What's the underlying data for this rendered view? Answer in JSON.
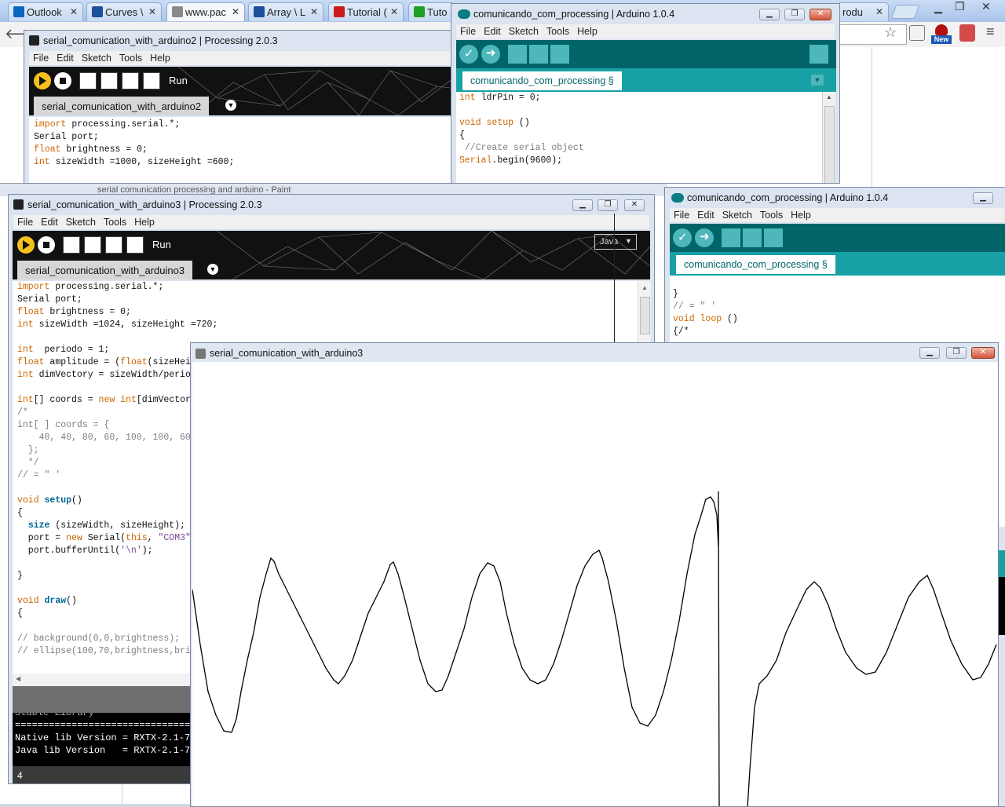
{
  "browser": {
    "tabs": [
      {
        "label": "Outlook",
        "color": "#0b64c0"
      },
      {
        "label": "Curves \\",
        "color": "#1c4e9a"
      },
      {
        "label": "www.pac",
        "color": "#8a8a8a"
      },
      {
        "label": "Array \\ L",
        "color": "#1c4e9a"
      },
      {
        "label": "Tutorial (",
        "color": "#cc1a1a"
      },
      {
        "label": "Tuto",
        "color": "#1fa023"
      }
    ],
    "far_tab": "rodu",
    "new_badge": "New"
  },
  "paint_behind_title": "serial comunication processing and arduino - Paint",
  "processing2": {
    "title": "serial_comunication_with_arduino2 | Processing 2.0.3",
    "menu": [
      "File",
      "Edit",
      "Sketch",
      "Tools",
      "Help"
    ],
    "run_label": "Run",
    "tab": "serial_comunication_with_arduino2",
    "code": [
      [
        {
          "t": "import",
          "c": "kw"
        },
        {
          "t": " processing.serial.*;"
        }
      ],
      [
        {
          "t": "Serial port;"
        }
      ],
      [
        {
          "t": "float",
          "c": "kt"
        },
        {
          "t": " brightness = 0;"
        }
      ],
      [
        {
          "t": "int",
          "c": "kt"
        },
        {
          "t": " sizeWidth =1000, sizeHeight =600;"
        }
      ]
    ]
  },
  "arduino1": {
    "title": "comunicando_com_processing | Arduino 1.0.4",
    "menu": [
      "File",
      "Edit",
      "Sketch",
      "Tools",
      "Help"
    ],
    "tab": "comunicando_com_processing §",
    "code": [
      [
        {
          "t": "int",
          "c": "kt"
        },
        {
          "t": " ldrPin = 0;"
        }
      ],
      [
        {
          "t": ""
        }
      ],
      [
        {
          "t": "void",
          "c": "kt"
        },
        {
          "t": " "
        },
        {
          "t": "setup",
          "c": "kw"
        },
        {
          "t": " ()"
        }
      ],
      [
        {
          "t": "{"
        }
      ],
      [
        {
          "t": " //Create serial object",
          "c": "cm"
        }
      ],
      [
        {
          "t": "Serial",
          "c": "kw"
        },
        {
          "t": ".begin(9600);"
        }
      ]
    ]
  },
  "arduino2": {
    "title": "comunicando_com_processing | Arduino 1.0.4",
    "menu": [
      "File",
      "Edit",
      "Sketch",
      "Tools",
      "Help"
    ],
    "tab": "comunicando_com_processing §",
    "code": [
      [
        {
          "t": ""
        }
      ],
      [
        {
          "t": "}"
        }
      ],
      [
        {
          "t": "// = \" '",
          "c": "cm"
        }
      ],
      [
        {
          "t": "void",
          "c": "kt"
        },
        {
          "t": " "
        },
        {
          "t": "loop",
          "c": "kw"
        },
        {
          "t": " ()"
        }
      ],
      [
        {
          "t": "{/*"
        }
      ]
    ]
  },
  "processing3": {
    "title": "serial_comunication_with_arduino3 | Processing 2.0.3",
    "menu": [
      "File",
      "Edit",
      "Sketch",
      "Tools",
      "Help"
    ],
    "run_label": "Run",
    "mode": "Java",
    "tab": "serial_comunication_with_arduino3",
    "code": [
      [
        {
          "t": "import",
          "c": "kw"
        },
        {
          "t": " processing.serial.*;"
        }
      ],
      [
        {
          "t": "Serial port;"
        }
      ],
      [
        {
          "t": "float",
          "c": "kt"
        },
        {
          "t": " brightness = 0;"
        }
      ],
      [
        {
          "t": "int",
          "c": "kt"
        },
        {
          "t": " sizeWidth =1024, sizeHeight =720;"
        }
      ],
      [
        {
          "t": ""
        }
      ],
      [
        {
          "t": "int",
          "c": "kt"
        },
        {
          "t": "  periodo = 1;"
        }
      ],
      [
        {
          "t": "float",
          "c": "kt"
        },
        {
          "t": " amplitude = ("
        },
        {
          "t": "float",
          "c": "kt"
        },
        {
          "t": "(sizeHei"
        }
      ],
      [
        {
          "t": "int",
          "c": "kt"
        },
        {
          "t": " dimVectory = sizeWidth/perio"
        }
      ],
      [
        {
          "t": ""
        }
      ],
      [
        {
          "t": "int",
          "c": "kt"
        },
        {
          "t": "[] coords = "
        },
        {
          "t": "new",
          "c": "kw"
        },
        {
          "t": " "
        },
        {
          "t": "int",
          "c": "kt"
        },
        {
          "t": "[dimVector"
        }
      ],
      [
        {
          "t": "/*",
          "c": "cm"
        }
      ],
      [
        {
          "t": "int[ ] coords = {",
          "c": "cm"
        }
      ],
      [
        {
          "t": "    40, 40, 80, 60, 100, 100, 60",
          "c": "cm"
        }
      ],
      [
        {
          "t": "  };",
          "c": "cm"
        }
      ],
      [
        {
          "t": "  */",
          "c": "cm"
        }
      ],
      [
        {
          "t": "// = \" '",
          "c": "cm"
        }
      ],
      [
        {
          "t": ""
        }
      ],
      [
        {
          "t": "void",
          "c": "kt"
        },
        {
          "t": " "
        },
        {
          "t": "setup",
          "c": "ab"
        },
        {
          "t": "()"
        }
      ],
      [
        {
          "t": "{"
        }
      ],
      [
        {
          "t": "  "
        },
        {
          "t": "size",
          "c": "ab"
        },
        {
          "t": " (sizeWidth, sizeHeight);"
        }
      ],
      [
        {
          "t": "  port = "
        },
        {
          "t": "new",
          "c": "kw"
        },
        {
          "t": " Serial("
        },
        {
          "t": "this",
          "c": "kw"
        },
        {
          "t": ", "
        },
        {
          "t": "\"COM3\"",
          "c": "st"
        }
      ],
      [
        {
          "t": "  port.bufferUntil("
        },
        {
          "t": "'\\n'",
          "c": "st"
        },
        {
          "t": ");"
        }
      ],
      [
        {
          "t": ""
        }
      ],
      [
        {
          "t": "}"
        }
      ],
      [
        {
          "t": ""
        }
      ],
      [
        {
          "t": "void",
          "c": "kt"
        },
        {
          "t": " "
        },
        {
          "t": "draw",
          "c": "ab"
        },
        {
          "t": "()"
        }
      ],
      [
        {
          "t": "{"
        }
      ],
      [
        {
          "t": ""
        }
      ],
      [
        {
          "t": "// background(0,0,brightness);",
          "c": "cm"
        }
      ],
      [
        {
          "t": "// ellipse(100,70,brightness,bri",
          "c": "cm"
        }
      ]
    ],
    "console_lines": [
      "Stable Library",
      "=========================================",
      "Native lib Version = RXTX-2.1-7",
      "Java lib Version   = RXTX-2.1-7"
    ],
    "line_number": "4"
  },
  "sketch_window": {
    "title": "serial_comunication_with_arduino3"
  },
  "colors": {
    "arduino_teal": "#006468",
    "arduino_tabbar": "#17a1a5",
    "processing_run": "#f6c11c"
  }
}
